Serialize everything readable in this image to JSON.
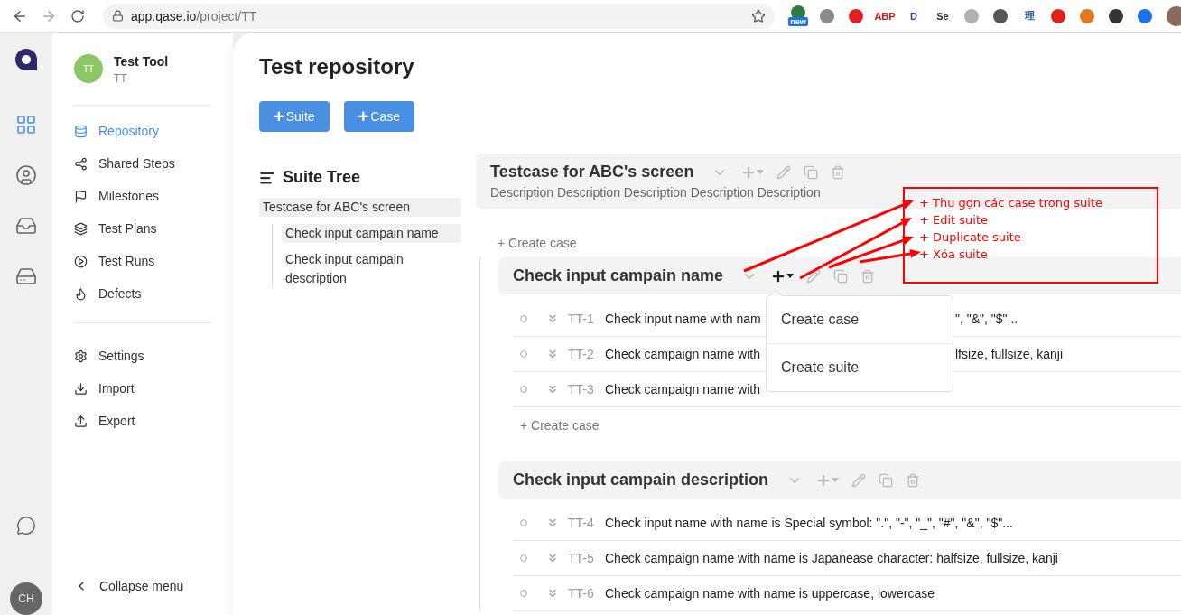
{
  "browser": {
    "url_host": "app.qase.io",
    "url_path": "/project/TT",
    "extensions": [
      {
        "kind": "icon",
        "color": "#2c7a3f",
        "badge": "new"
      },
      {
        "kind": "icon",
        "color": "#8a8a8a"
      },
      {
        "kind": "icon",
        "color": "#e02020"
      },
      {
        "kind": "text",
        "label": "ABP",
        "color": "#d11a1a"
      },
      {
        "kind": "text",
        "label": "D",
        "color": "#2c4a9a"
      },
      {
        "kind": "text",
        "label": "Se",
        "color": "#333333"
      },
      {
        "kind": "icon",
        "color": "#b0b0b0"
      },
      {
        "kind": "icon",
        "color": "#555555"
      },
      {
        "kind": "text",
        "label": "理",
        "color": "#2a5db0"
      },
      {
        "kind": "icon",
        "color": "#e0201a"
      },
      {
        "kind": "icon",
        "color": "#e07a20"
      },
      {
        "kind": "icon",
        "color": "#333333"
      },
      {
        "kind": "icon",
        "color": "#1a73e8"
      }
    ]
  },
  "rail": {
    "items": [
      {
        "selected": true
      },
      {
        "selected": false
      },
      {
        "selected": false
      },
      {
        "selected": false
      }
    ],
    "user_avatar": "CH"
  },
  "sidebar": {
    "project": {
      "avatar": "TT",
      "name": "Test Tool",
      "code": "TT"
    },
    "groups": [
      [
        {
          "label": "Repository",
          "selected": true
        },
        {
          "label": "Shared Steps",
          "selected": false
        },
        {
          "label": "Milestones",
          "selected": false
        },
        {
          "label": "Test Plans",
          "selected": false
        },
        {
          "label": "Test Runs",
          "selected": false
        },
        {
          "label": "Defects",
          "selected": false
        }
      ],
      [
        {
          "label": "Settings",
          "selected": false
        },
        {
          "label": "Import",
          "selected": false
        },
        {
          "label": "Export",
          "selected": false
        }
      ]
    ],
    "collapse": "Collapse menu"
  },
  "page": {
    "title": "Test repository",
    "buttons": [
      {
        "icon": "+",
        "label": "Suite"
      },
      {
        "icon": "+",
        "label": "Case"
      }
    ]
  },
  "suite_tree": {
    "title": "Suite Tree",
    "items": [
      {
        "label": "Testcase for ABC's screen",
        "selected": true,
        "children": [
          {
            "label": "Check input campain name",
            "selected": true
          },
          {
            "label": "Check input campain description",
            "selected": false
          }
        ]
      }
    ]
  },
  "suites": [
    {
      "title": "Testcase for ABC's screen",
      "description": "Description Description Description Description Description",
      "menu_open": false,
      "create_case": "+ Create case",
      "children": [
        {
          "title": "Check input campain name",
          "menu_open": true,
          "menu": [
            "Create case",
            "Create suite"
          ],
          "create_case": "+ Create case",
          "cases": [
            {
              "id": "TT-1",
              "title": "Check input name with nam",
              "title_after": "\", \"&\", \"$\"..."
            },
            {
              "id": "TT-2",
              "title": "Check campaign name with",
              "title_after": "lfsize, fullsize, kanji"
            },
            {
              "id": "TT-3",
              "title": "Check campaign name with"
            }
          ]
        },
        {
          "title": "Check input campain description",
          "menu_open": false,
          "cases": [
            {
              "id": "TT-4",
              "title": "Check input name with name is Special symbol: \".\", \"-\", \"_\", \"#\", \"&\", \"$\"..."
            },
            {
              "id": "TT-5",
              "title": "Check campaign name with name is Japanease character: halfsize, fullsize, kanji"
            },
            {
              "id": "TT-6",
              "title": "Check campaign name with name is uppercase, lowercase"
            }
          ]
        }
      ]
    }
  ],
  "annotation": {
    "lines": [
      "+ Thu gọn các case trong suite",
      "+ Edit suite",
      "+ Duplicate suite",
      "+ Xóa suite"
    ]
  }
}
